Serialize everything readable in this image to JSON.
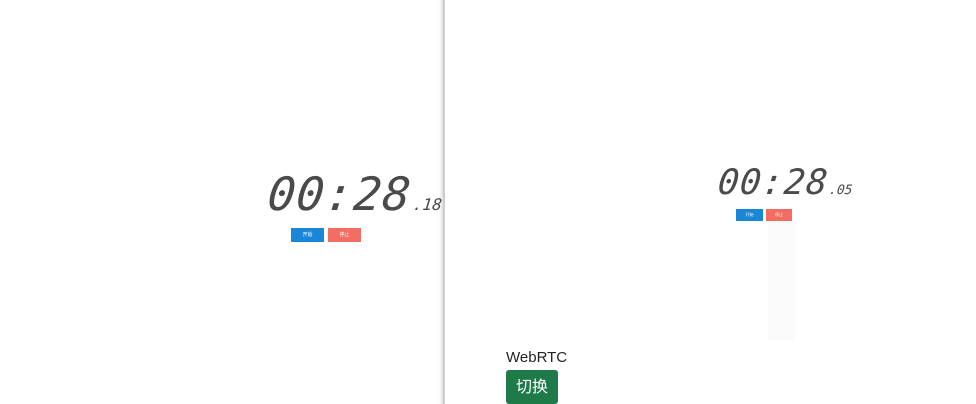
{
  "left_panel": {
    "clock": {
      "main": "00:28",
      "fraction": ".18"
    },
    "start_button": "开始",
    "stop_button": "停止"
  },
  "right_panel": {
    "clock": {
      "main": "00:28",
      "fraction": ".05"
    },
    "start_button": "开始",
    "stop_button": "停止",
    "webrtc_label": "WebRTC",
    "switch_button": "切换"
  },
  "colors": {
    "clock_text": "#4a4a4a",
    "start_blue": "#1a86d8",
    "stop_salmon": "#f36d63",
    "switch_green": "#1f7a4a"
  }
}
